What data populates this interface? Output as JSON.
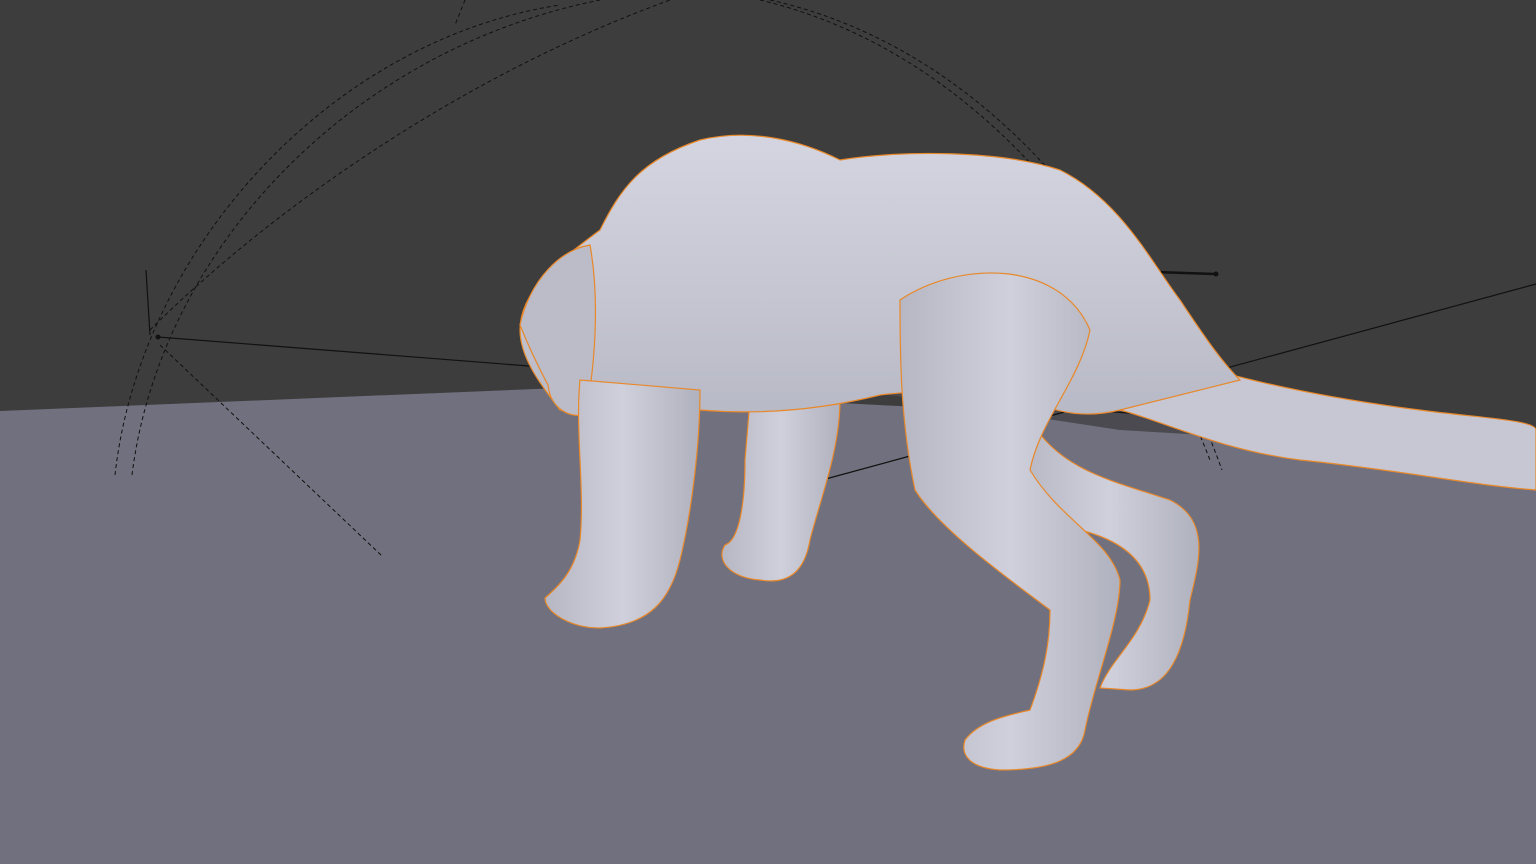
{
  "viewport": {
    "colors": {
      "background": "#3d3d3d",
      "floor": "#70707e",
      "floor_shadow": "#4a4a4e",
      "model_fill": "#c8c9d4",
      "model_highlight": "#d6d7e2",
      "model_shade": "#a9aab6",
      "selection_outline": "#e8882a",
      "helper_lines": "#111111"
    }
  }
}
